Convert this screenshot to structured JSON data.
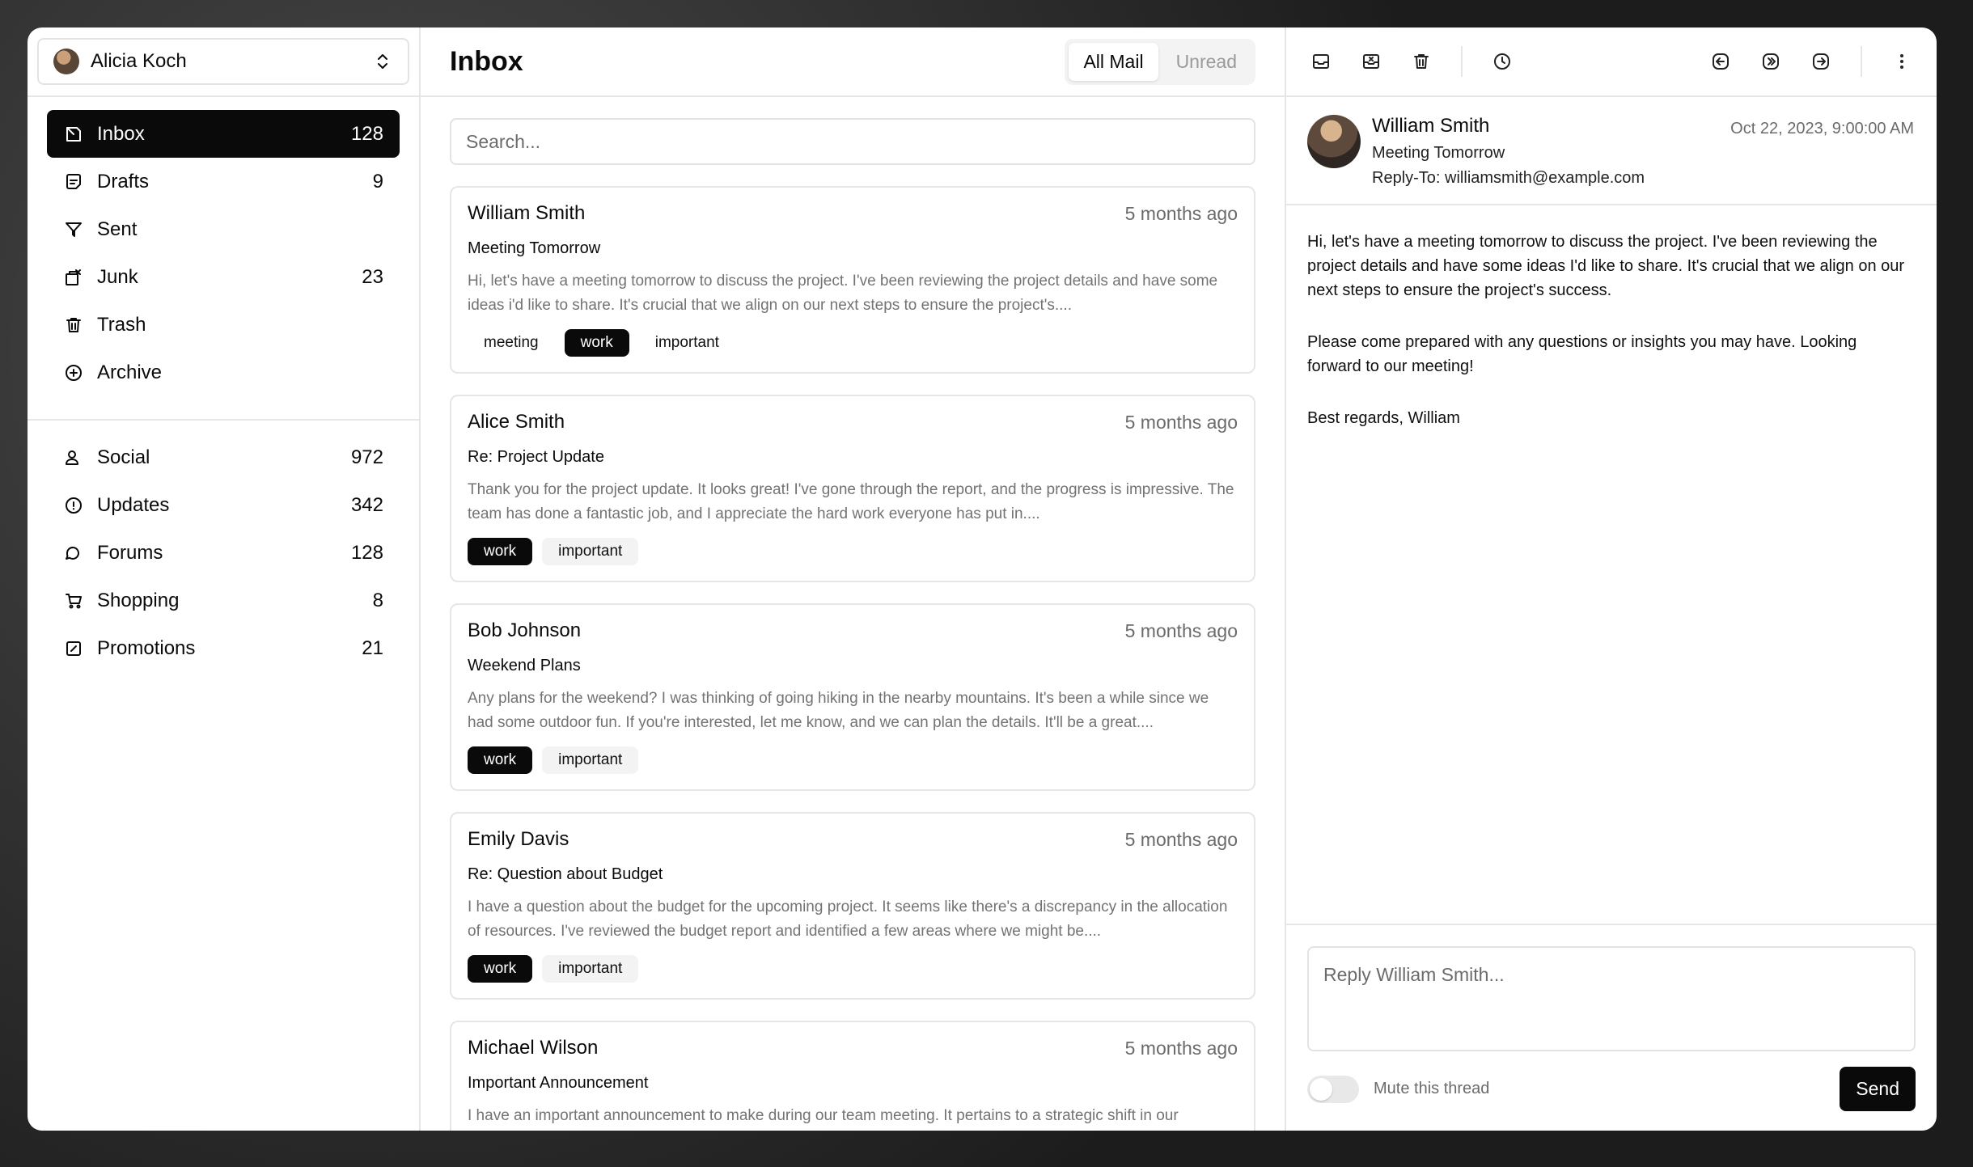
{
  "account": {
    "name": "Alicia Koch"
  },
  "nav_primary": [
    {
      "label": "Inbox",
      "count": "128",
      "icon": "inbox-icon",
      "active": true
    },
    {
      "label": "Drafts",
      "count": "9",
      "icon": "file-icon"
    },
    {
      "label": "Sent",
      "count": "",
      "icon": "send-icon"
    },
    {
      "label": "Junk",
      "count": "23",
      "icon": "archive-x-icon"
    },
    {
      "label": "Trash",
      "count": "",
      "icon": "trash-icon"
    },
    {
      "label": "Archive",
      "count": "",
      "icon": "archive-icon"
    }
  ],
  "nav_secondary": [
    {
      "label": "Social",
      "count": "972",
      "icon": "users-icon"
    },
    {
      "label": "Updates",
      "count": "342",
      "icon": "alert-circle-icon"
    },
    {
      "label": "Forums",
      "count": "128",
      "icon": "message-square-icon"
    },
    {
      "label": "Shopping",
      "count": "8",
      "icon": "shopping-cart-icon"
    },
    {
      "label": "Promotions",
      "count": "21",
      "icon": "percent-icon"
    }
  ],
  "list": {
    "title": "Inbox",
    "tabs": [
      "All Mail",
      "Unread"
    ],
    "search_placeholder": "Search...",
    "mails": [
      {
        "from": "William Smith",
        "time": "5 months ago",
        "subject": "Meeting Tomorrow",
        "preview": "Hi, let's have a meeting tomorrow to discuss the project. I've been reviewing the project details and have some ideas i'd like to share. It's crucial that we align on our next steps to ensure the project's....",
        "tags": [
          "meeting",
          "work",
          "important"
        ]
      },
      {
        "from": "Alice Smith",
        "time": "5 months ago",
        "subject": "Re: Project Update",
        "preview": "Thank you for the project update. It looks great! I've gone through the report, and the progress is impressive. The team has done a fantastic job, and I appreciate the hard work everyone has put in....",
        "tags": [
          "work",
          "important"
        ]
      },
      {
        "from": "Bob Johnson",
        "time": "5 months ago",
        "subject": "Weekend Plans",
        "preview": "Any plans for the weekend? I was thinking of going hiking in the nearby mountains. It's been a while since we had some outdoor fun. If you're interested, let me know, and we can plan the details. It'll be a great....",
        "tags": [
          "work",
          "important"
        ]
      },
      {
        "from": "Emily Davis",
        "time": "5 months ago",
        "subject": "Re: Question about Budget",
        "preview": "I have a question about the budget for the upcoming project. It seems like there's a discrepancy in the allocation of resources. I've reviewed the budget report and identified a few areas where we might be....",
        "tags": [
          "work",
          "important"
        ]
      },
      {
        "from": "Michael Wilson",
        "time": "5 months ago",
        "subject": "Important Announcement",
        "preview": "I have an important announcement to make during our team meeting. It pertains to a strategic shift in our",
        "tags": []
      }
    ]
  },
  "reader": {
    "from": "William Smith",
    "subject": "Meeting Tomorrow",
    "reply_to_label": "Reply-To:",
    "reply_to": "williamsmith@example.com",
    "date": "Oct 22, 2023, 9:00:00 AM",
    "body": [
      "Hi, let's have a meeting tomorrow to discuss the project. I've been reviewing the project details and have some ideas I'd like to share. It's crucial that we align on our next steps to ensure the project's success.",
      "Please come prepared with any questions or insights you may have. Looking forward to our meeting!",
      "Best regards, William"
    ],
    "reply_placeholder": "Reply William Smith...",
    "mute_label": "Mute this thread",
    "send_label": "Send"
  }
}
